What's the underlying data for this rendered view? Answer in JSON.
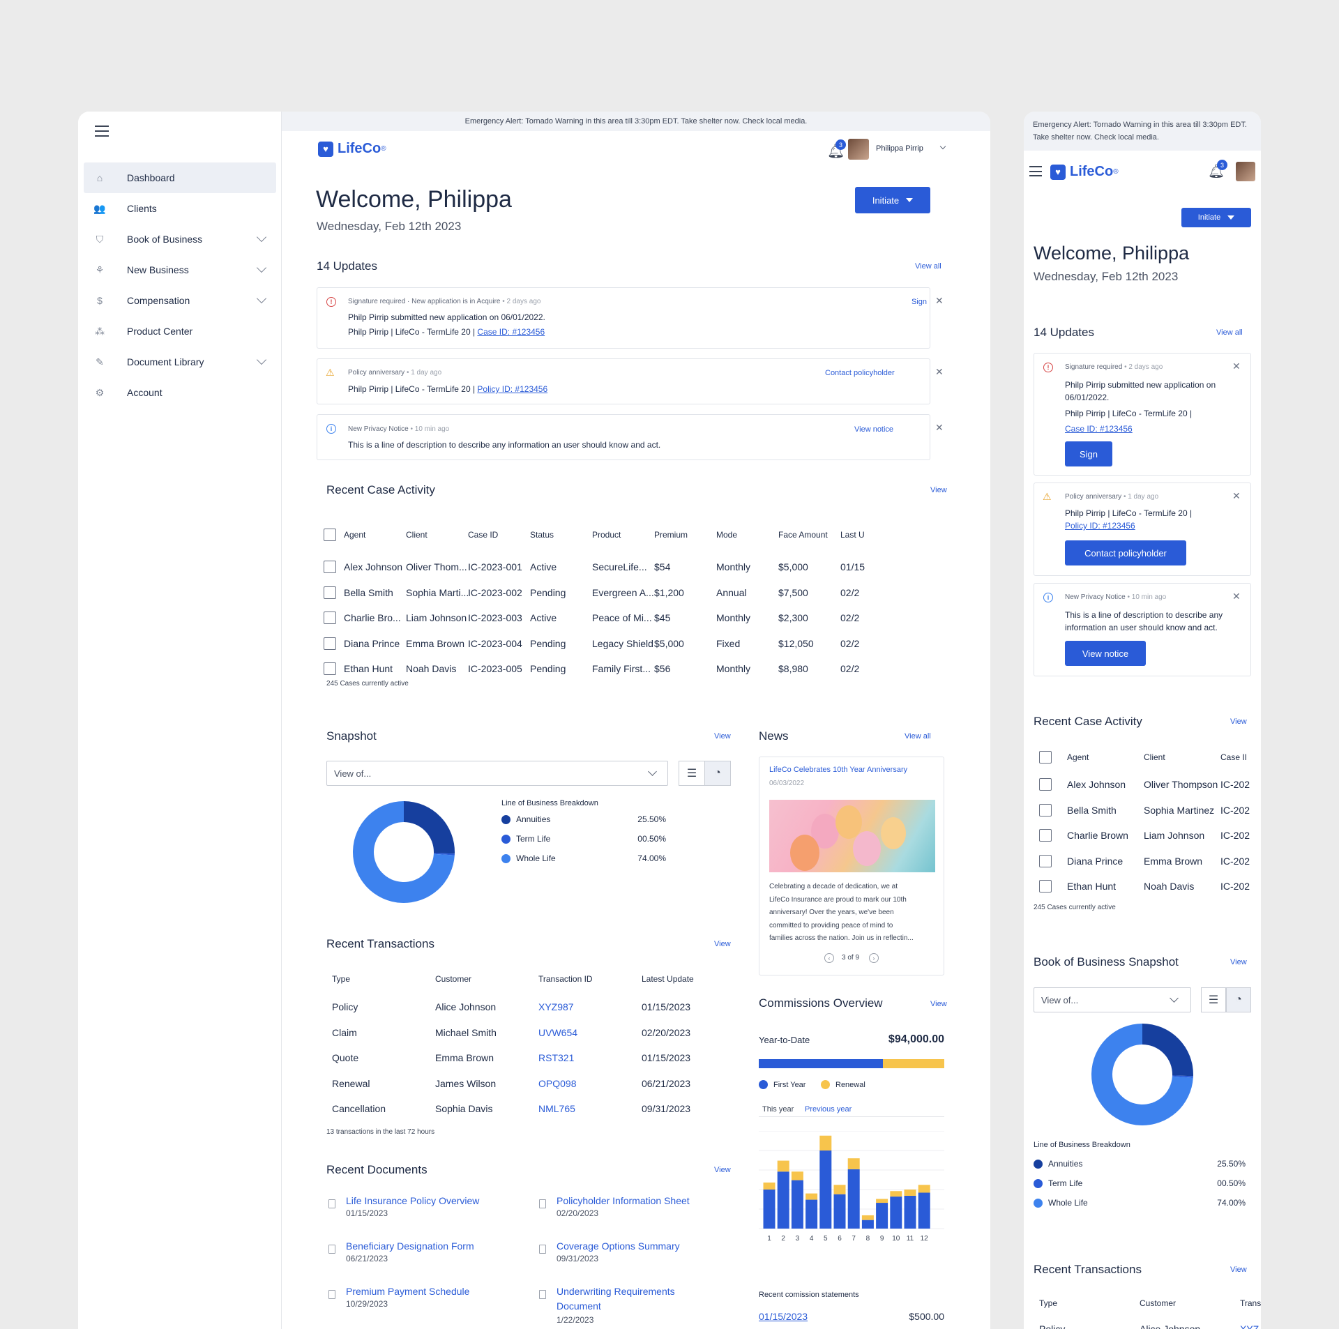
{
  "alert": "Emergency Alert: Tornado Warning in this area till 3:30pm EDT. Take shelter now. Check local media.",
  "brand": {
    "name": "LifeCo",
    "reg": "®",
    "color": "#2a5bd7"
  },
  "sidebar": {
    "items": [
      {
        "label": "Dashboard",
        "icon": "home-icon",
        "glyph": "⌂",
        "active": true
      },
      {
        "label": "Clients",
        "icon": "users-icon",
        "glyph": "👥"
      },
      {
        "label": "Book of Business",
        "icon": "shield-icon",
        "glyph": "⛉",
        "chevron": true
      },
      {
        "label": "New Business",
        "icon": "sprout-icon",
        "glyph": "⚘",
        "chevron": true
      },
      {
        "label": "Compensation",
        "icon": "hand-dollar-icon",
        "glyph": "$",
        "chevron": true
      },
      {
        "label": "Product Center",
        "icon": "cubes-icon",
        "glyph": "⁂"
      },
      {
        "label": "Document Library",
        "icon": "document-edit-icon",
        "glyph": "✎",
        "chevron": true
      },
      {
        "label": "Account",
        "icon": "gear-icon",
        "glyph": "⚙"
      }
    ]
  },
  "header": {
    "notif_count": "3",
    "user_name": "Philippa Pirrip"
  },
  "welcome": {
    "title": "Welcome, Philippa",
    "date": "Wednesday, Feb 12th 2023",
    "initiate": "Initiate"
  },
  "updates": {
    "title": "14 Updates",
    "view_all": "View all",
    "items": [
      {
        "type": "error",
        "kind": "Signature required",
        "sep": "·",
        "context": "New application is in Acquire",
        "time": "2 days ago",
        "line1": "Philp Pirrip submitted new application on 06/01/2022.",
        "line2": "Philp Pirrip | LifeCo - TermLife 20 | ",
        "link": "Case ID: #123456",
        "action": "Sign"
      },
      {
        "type": "warning",
        "kind": "Policy anniversary",
        "time": "1 day ago",
        "line2": "Philp Pirrip | LifeCo - TermLife 20 | ",
        "link": "Policy ID: #123456",
        "action": "Contact policyholder"
      },
      {
        "type": "info",
        "kind": "New Privacy Notice",
        "time": "10 min ago",
        "line1": "This is a line of description to describe any information an user should know and act.",
        "action": "View notice"
      }
    ],
    "mobile_line1_a": "Philp Pirrip submitted new application on",
    "mobile_line1_b": "06/01/2022.",
    "mobile_line2": "Philp Pirrip | LifeCo - TermLife 20 |",
    "mobile_info_a": "This is a line of description to describe any",
    "mobile_info_b": "information an user should know and act."
  },
  "cases": {
    "title": "Recent Case Activity",
    "view": "View",
    "footer": "245 Cases currently active",
    "columns": [
      "Agent",
      "Client",
      "Case ID",
      "Status",
      "Product",
      "Premium",
      "Mode",
      "Face Amount",
      "Last U"
    ],
    "rows": [
      [
        "Alex Johnson",
        "Oliver Thom...",
        "IC-2023-001",
        "Active",
        "SecureLife...",
        "$54",
        "Monthly",
        "$5,000",
        "01/15"
      ],
      [
        "Bella Smith",
        "Sophia Marti...",
        "IC-2023-002",
        "Pending",
        "Evergreen A...",
        "$1,200",
        "Annual",
        "$7,500",
        "02/2"
      ],
      [
        "Charlie Bro...",
        "Liam Johnson",
        "IC-2023-003",
        "Active",
        "Peace of Mi...",
        "$45",
        "Monthly",
        "$2,300",
        "02/2"
      ],
      [
        "Diana Prince",
        "Emma Brown",
        "IC-2023-004",
        "Pending",
        "Legacy Shield",
        "$5,000",
        "Fixed",
        "$12,050",
        "02/2"
      ],
      [
        "Ethan Hunt",
        "Noah Davis",
        "IC-2023-005",
        "Pending",
        "Family First...",
        "$56",
        "Monthly",
        "$8,980",
        "02/2"
      ]
    ],
    "mobile_columns": [
      "Agent",
      "Client",
      "Case II"
    ],
    "mobile_rows": [
      [
        "Alex Johnson",
        "Oliver Thompson",
        "IC-202"
      ],
      [
        "Bella Smith",
        "Sophia Martinez",
        "IC-202"
      ],
      [
        "Charlie Brown",
        "Liam Johnson",
        "IC-202"
      ],
      [
        "Diana Prince",
        "Emma Brown",
        "IC-202"
      ],
      [
        "Ethan Hunt",
        "Noah Davis",
        "IC-202"
      ]
    ]
  },
  "snapshot": {
    "title": "Snapshot",
    "mobile_title": "Book of Business Snapshot",
    "view": "View",
    "select_placeholder": "View of...",
    "legend_title": "Line of Business Breakdown",
    "chart_data": {
      "type": "pie",
      "donut": true,
      "title": "Line of Business Breakdown",
      "slices": [
        {
          "label": "Annuities",
          "value": 25.5,
          "display": "25.50%",
          "color": "#163f9e"
        },
        {
          "label": "Term Life",
          "value": 0.5,
          "display": "00.50%",
          "color": "#2a5bd7"
        },
        {
          "label": "Whole Life",
          "value": 74.0,
          "display": "74.00%",
          "color": "#3d82ee"
        }
      ]
    }
  },
  "news": {
    "title": "News",
    "view_all": "View all",
    "headline": "LifeCo Celebrates 10th Year Anniversary",
    "date": "06/03/2022",
    "body": [
      "Celebrating a decade of dedication, we at",
      "LifeCo Insurance are proud to mark our 10th",
      "anniversary! Over the years, we've been",
      "committed to providing peace of mind to",
      "families across the nation. Join us in reflectin..."
    ],
    "pager": "3 of 9"
  },
  "transactions": {
    "title": "Recent Transactions",
    "view": "View",
    "footer": "13 transactions in the last 72 hours",
    "columns": [
      "Type",
      "Customer",
      "Transaction ID",
      "Latest Update"
    ],
    "rows": [
      [
        "Policy",
        "Alice Johnson",
        "XYZ987",
        "01/15/2023"
      ],
      [
        "Claim",
        "Michael Smith",
        "UVW654",
        "02/20/2023"
      ],
      [
        "Quote",
        "Emma Brown",
        "RST321",
        "01/15/2023"
      ],
      [
        "Renewal",
        "James Wilson",
        "OPQ098",
        "06/21/2023"
      ],
      [
        "Cancellation",
        "Sophia Davis",
        "NML765",
        "09/31/2023"
      ]
    ],
    "mobile_columns": [
      "Type",
      "Customer",
      "Trans"
    ],
    "mobile_row": [
      "Policy",
      "Alice Johnson",
      "XYZ"
    ]
  },
  "commissions": {
    "title": "Commissions Overview",
    "view": "View",
    "ytd_label": "Year-to-Date",
    "ytd_value": "$94,000.00",
    "first_year_fraction": 0.67,
    "legend": [
      "First Year",
      "Renewal"
    ],
    "colors": {
      "first_year": "#2a5bd7",
      "renewal": "#f7c44c"
    },
    "tabs": [
      "This year",
      "Previous year"
    ],
    "chart_data": {
      "type": "bar",
      "stacked": true,
      "categories": [
        "1",
        "2",
        "3",
        "4",
        "5",
        "6",
        "7",
        "8",
        "9",
        "10",
        "11",
        "12"
      ],
      "series": [
        {
          "name": "First Year",
          "values": [
            50,
            73,
            62,
            37,
            100,
            44,
            76,
            11,
            33,
            41,
            42,
            46
          ],
          "color": "#2a5bd7"
        },
        {
          "name": "Renewal",
          "values": [
            9,
            14,
            11,
            8,
            19,
            12,
            14,
            6,
            5,
            7,
            8,
            10
          ],
          "color": "#f7c44c"
        }
      ],
      "ylim": [
        0,
        125
      ]
    },
    "statements_title": "Recent comission statements",
    "statement_date": "01/15/2023",
    "statement_amount": "$500.00"
  },
  "documents": {
    "title": "Recent Documents",
    "view": "View",
    "items": [
      {
        "title": "Life Insurance Policy Overview",
        "date": "01/15/2023"
      },
      {
        "title": "Policyholder Information Sheet",
        "date": "02/20/2023"
      },
      {
        "title": "Beneficiary Designation Form",
        "date": "06/21/2023"
      },
      {
        "title": "Coverage Options Summary",
        "date": "09/31/2023"
      },
      {
        "title": "Premium Payment Schedule",
        "date": "10/29/2023"
      },
      {
        "title": "Underwriting Requirements",
        "title2": "Document",
        "date": "1/22/2023"
      }
    ]
  }
}
